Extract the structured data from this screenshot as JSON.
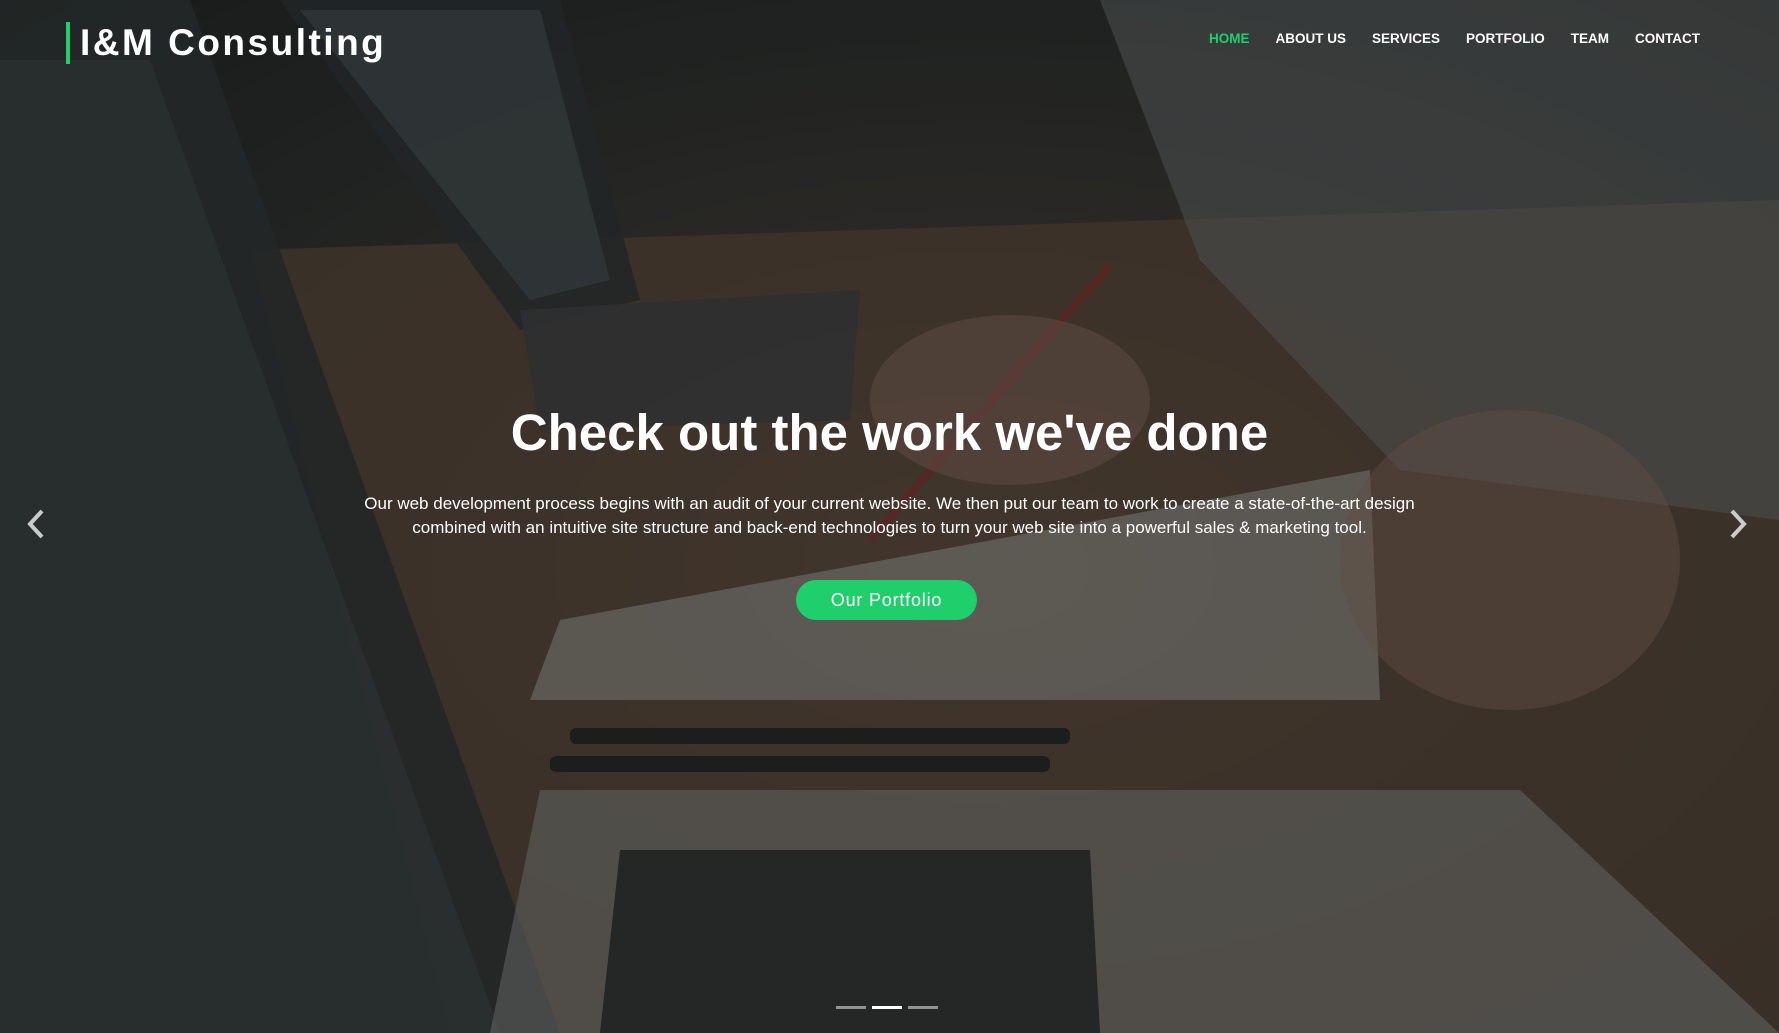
{
  "brand": {
    "name": "I&M Consulting",
    "accent_color": "#1fcf6b"
  },
  "nav": {
    "items": [
      {
        "label": "HOME",
        "active": true
      },
      {
        "label": "ABOUT US",
        "active": false
      },
      {
        "label": "SERVICES",
        "active": false
      },
      {
        "label": "PORTFOLIO",
        "active": false
      },
      {
        "label": "TEAM",
        "active": false
      },
      {
        "label": "CONTACT",
        "active": false
      }
    ]
  },
  "hero": {
    "headline": "Check out the work we've done",
    "text_line_1": "Our web development process begins with an audit of your current website. We then put our team to work to create a state-of-the-art design",
    "text_line_2": "combined with an intuitive site structure and back-end technologies to turn your web site into a powerful sales & marketing tool.",
    "cta_label": "Our Portfolio",
    "cta_color": "#1fcf6b"
  },
  "carousel": {
    "prev_icon": "chevron-left-icon",
    "next_icon": "chevron-right-icon",
    "slide_count": 3,
    "active_slide": 2
  }
}
